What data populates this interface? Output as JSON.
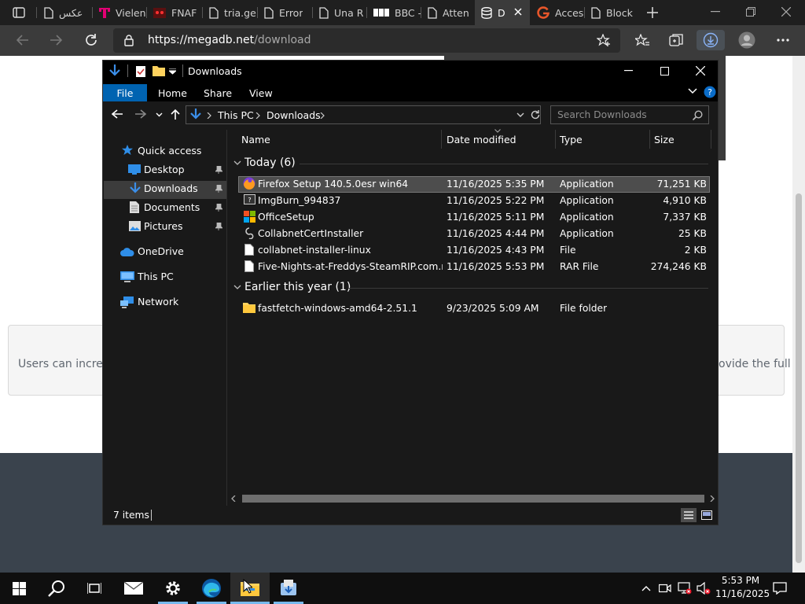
{
  "browser": {
    "tabs": [
      {
        "label": "عكس",
        "icon": "doc-icon"
      },
      {
        "label": "Vielen",
        "icon": "t-mobile-icon"
      },
      {
        "label": "FNAF",
        "icon": "fnaf-icon"
      },
      {
        "label": "tria.ge",
        "icon": "doc-icon"
      },
      {
        "label": "Error",
        "icon": "doc-icon"
      },
      {
        "label": "Una R",
        "icon": "doc-icon"
      },
      {
        "label": "BBC -",
        "icon": "bbc-icon"
      },
      {
        "label": "Atten",
        "icon": "doc-icon"
      },
      {
        "label": "D",
        "icon": "database-icon",
        "active": true
      },
      {
        "label": "Acces",
        "icon": "g-icon"
      },
      {
        "label": "Block",
        "icon": "doc-icon"
      }
    ],
    "url_host": "https://megadb.net",
    "url_path": "/download"
  },
  "page": {
    "left_text": "Users can increas",
    "right_text": "ovide the full"
  },
  "explorer": {
    "title": "Downloads",
    "ribbon": [
      "File",
      "Home",
      "Share",
      "View"
    ],
    "breadcrumb": [
      "This PC",
      "Downloads"
    ],
    "search_placeholder": "Search Downloads",
    "columns": {
      "name": "Name",
      "date": "Date modified",
      "type": "Type",
      "size": "Size"
    },
    "sidebar": {
      "quick_access": "Quick access",
      "desktop": "Desktop",
      "downloads": "Downloads",
      "documents": "Documents",
      "pictures": "Pictures",
      "onedrive": "OneDrive",
      "thispc": "This PC",
      "network": "Network"
    },
    "groups": [
      {
        "label": "Today (6)",
        "files": [
          {
            "name": "Firefox Setup 140.5.0esr win64",
            "date": "11/16/2025 5:35 PM",
            "type": "Application",
            "size": "71,251 KB",
            "icon": "firefox-icon",
            "selected": true
          },
          {
            "name": "ImgBurn_994837",
            "date": "11/16/2025 5:22 PM",
            "type": "Application",
            "size": "4,910 KB",
            "icon": "imgburn-icon"
          },
          {
            "name": "OfficeSetup",
            "date": "11/16/2025 5:11 PM",
            "type": "Application",
            "size": "7,337 KB",
            "icon": "office-icon"
          },
          {
            "name": "CollabnetCertInstaller",
            "date": "11/16/2025 4:44 PM",
            "type": "Application",
            "size": "25 KB",
            "icon": "installer-icon"
          },
          {
            "name": "collabnet-installer-linux",
            "date": "11/16/2025 4:43 PM",
            "type": "File",
            "size": "2 KB",
            "icon": "file-icon"
          },
          {
            "name": "Five-Nights-at-Freddys-SteamRIP.com.rar",
            "date": "11/16/2025 5:53 PM",
            "type": "RAR File",
            "size": "274,246 KB",
            "icon": "file-icon"
          }
        ]
      },
      {
        "label": "Earlier this year (1)",
        "files": [
          {
            "name": "fastfetch-windows-amd64-2.51.1",
            "date": "9/23/2025 5:09 AM",
            "type": "File folder",
            "size": "",
            "icon": "folder-icon"
          }
        ]
      }
    ],
    "status": "7 items"
  },
  "taskbar": {
    "time": "5:53 PM",
    "date": "11/16/2025"
  },
  "colors": {
    "explorer_bg": "#191919",
    "ribbon_blue": "#0063b1",
    "selection": "#4d4d4d",
    "folder": "#ffd25e",
    "taskbar": "#0f0f0f"
  }
}
